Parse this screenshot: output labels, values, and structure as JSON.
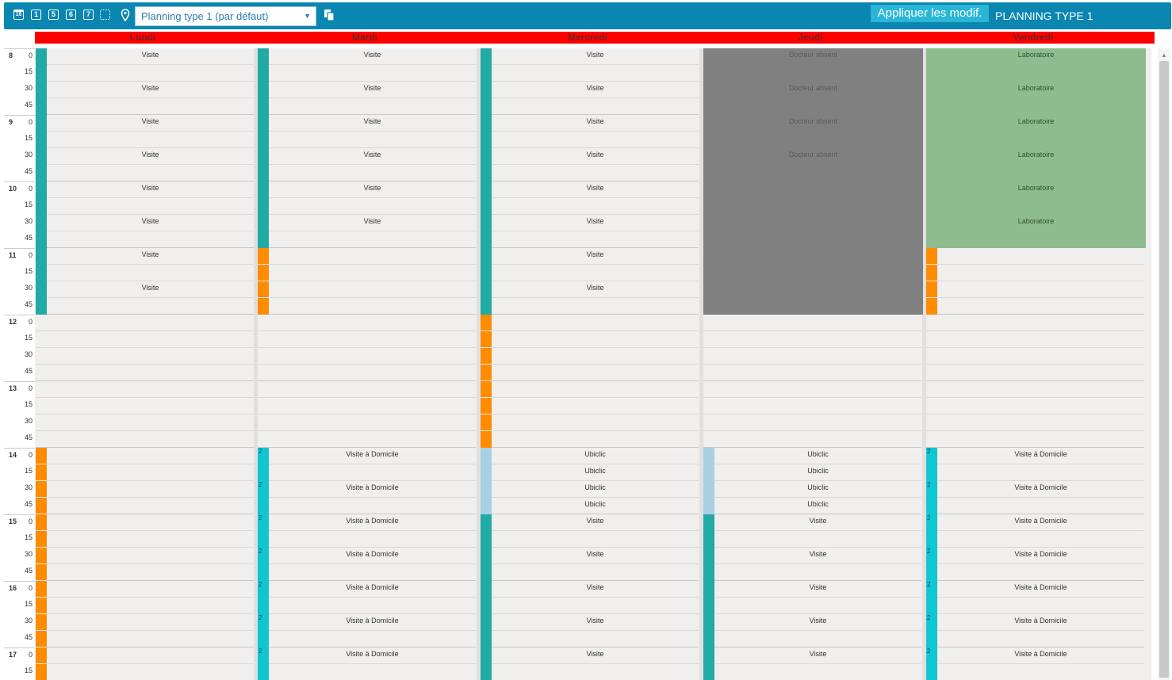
{
  "toolbar": {
    "icons": [
      "calendar-16-icon",
      "day-1-icon",
      "days-5-icon",
      "days-6-icon",
      "days-7-icon",
      "calendar-multi-icon",
      "location-pin-icon",
      "copy-icon"
    ],
    "icon_labels": {
      "cal16": "16",
      "d1": "1",
      "d5": "5",
      "d6": "6",
      "d7": "7"
    },
    "planning_select": {
      "value": "Planning type 1 (par défaut)"
    },
    "apply_label": "Appliquer les modif.",
    "planning_label": "PLANNING TYPE 1",
    "bg_color": "#0a86b0"
  },
  "days": [
    "Lundi",
    "Mardi",
    "Mercredi",
    "Jeudi",
    "Vendredi"
  ],
  "header_color": "#ff0000",
  "time_rows": [
    {
      "hour": "8",
      "min": "0"
    },
    {
      "hour": "",
      "min": "15"
    },
    {
      "hour": "",
      "min": "30"
    },
    {
      "hour": "",
      "min": "45"
    },
    {
      "hour": "9",
      "min": "0"
    },
    {
      "hour": "",
      "min": "15"
    },
    {
      "hour": "",
      "min": "30"
    },
    {
      "hour": "",
      "min": "45"
    },
    {
      "hour": "10",
      "min": "0"
    },
    {
      "hour": "",
      "min": "15"
    },
    {
      "hour": "",
      "min": "30"
    },
    {
      "hour": "",
      "min": "45"
    },
    {
      "hour": "11",
      "min": "0"
    },
    {
      "hour": "",
      "min": "15"
    },
    {
      "hour": "",
      "min": "30"
    },
    {
      "hour": "",
      "min": "45"
    },
    {
      "hour": "12",
      "min": "0"
    },
    {
      "hour": "",
      "min": "15"
    },
    {
      "hour": "",
      "min": "30"
    },
    {
      "hour": "",
      "min": "45"
    },
    {
      "hour": "13",
      "min": "0"
    },
    {
      "hour": "",
      "min": "15"
    },
    {
      "hour": "",
      "min": "30"
    },
    {
      "hour": "",
      "min": "45"
    },
    {
      "hour": "14",
      "min": "0"
    },
    {
      "hour": "",
      "min": "15"
    },
    {
      "hour": "",
      "min": "30"
    },
    {
      "hour": "",
      "min": "45"
    },
    {
      "hour": "15",
      "min": "0"
    },
    {
      "hour": "",
      "min": "15"
    },
    {
      "hour": "",
      "min": "30"
    },
    {
      "hour": "",
      "min": "45"
    },
    {
      "hour": "16",
      "min": "0"
    },
    {
      "hour": "",
      "min": "15"
    },
    {
      "hour": "",
      "min": "30"
    },
    {
      "hour": "",
      "min": "45"
    },
    {
      "hour": "17",
      "min": "0"
    },
    {
      "hour": "",
      "min": "15"
    }
  ],
  "colors": {
    "visite": "#22aaa6",
    "domicile": "#0fc6d1",
    "ubiclic": "#a9cfe3",
    "orange": "#ff8c00",
    "absent": "#808080",
    "lab": "#8fbc8f"
  },
  "schedule": [
    {
      "day": "Lundi",
      "events": [
        {
          "start": "8:00",
          "end": "8:30",
          "type": "visite",
          "label": "Visite"
        },
        {
          "start": "8:30",
          "end": "9:00",
          "type": "visite",
          "label": "Visite"
        },
        {
          "start": "9:00",
          "end": "9:30",
          "type": "visite",
          "label": "Visite"
        },
        {
          "start": "9:30",
          "end": "10:00",
          "type": "visite",
          "label": "Visite"
        },
        {
          "start": "10:00",
          "end": "10:30",
          "type": "visite",
          "label": "Visite"
        },
        {
          "start": "10:30",
          "end": "11:00",
          "type": "visite",
          "label": "Visite"
        },
        {
          "start": "11:00",
          "end": "11:30",
          "type": "visite",
          "label": "Visite"
        },
        {
          "start": "11:30",
          "end": "12:00",
          "type": "visite",
          "label": "Visite"
        },
        {
          "start": "14:00",
          "end": "17:30",
          "type": "orange",
          "label": ""
        }
      ]
    },
    {
      "day": "Mardi",
      "events": [
        {
          "start": "8:00",
          "end": "8:30",
          "type": "visite",
          "label": "Visite"
        },
        {
          "start": "8:30",
          "end": "9:00",
          "type": "visite",
          "label": "Visite"
        },
        {
          "start": "9:00",
          "end": "9:30",
          "type": "visite",
          "label": "Visite"
        },
        {
          "start": "9:30",
          "end": "10:00",
          "type": "visite",
          "label": "Visite"
        },
        {
          "start": "10:00",
          "end": "10:30",
          "type": "visite",
          "label": "Visite"
        },
        {
          "start": "10:30",
          "end": "11:00",
          "type": "visite",
          "label": "Visite"
        },
        {
          "start": "11:00",
          "end": "12:00",
          "type": "orange",
          "label": ""
        },
        {
          "start": "14:00",
          "end": "14:30",
          "type": "domicile",
          "label": "Visite à Domicile",
          "num": "2"
        },
        {
          "start": "14:30",
          "end": "15:00",
          "type": "domicile",
          "label": "Visite à Domicile",
          "num": "2"
        },
        {
          "start": "15:00",
          "end": "15:30",
          "type": "domicile",
          "label": "Visite à Domicile",
          "num": "2"
        },
        {
          "start": "15:30",
          "end": "16:00",
          "type": "domicile",
          "label": "Visite à Domicile",
          "num": "2"
        },
        {
          "start": "16:00",
          "end": "16:30",
          "type": "domicile",
          "label": "Visite à Domicile",
          "num": "2"
        },
        {
          "start": "16:30",
          "end": "17:00",
          "type": "domicile",
          "label": "Visite à Domicile",
          "num": "2"
        },
        {
          "start": "17:00",
          "end": "17:30",
          "type": "domicile",
          "label": "Visite à Domicile",
          "num": "2"
        }
      ]
    },
    {
      "day": "Mercredi",
      "events": [
        {
          "start": "8:00",
          "end": "8:30",
          "type": "visite",
          "label": "Visite"
        },
        {
          "start": "8:30",
          "end": "9:00",
          "type": "visite",
          "label": "Visite"
        },
        {
          "start": "9:00",
          "end": "9:30",
          "type": "visite",
          "label": "Visite"
        },
        {
          "start": "9:30",
          "end": "10:00",
          "type": "visite",
          "label": "Visite"
        },
        {
          "start": "10:00",
          "end": "10:30",
          "type": "visite",
          "label": "Visite"
        },
        {
          "start": "10:30",
          "end": "11:00",
          "type": "visite",
          "label": "Visite"
        },
        {
          "start": "11:00",
          "end": "11:30",
          "type": "visite",
          "label": "Visite"
        },
        {
          "start": "11:30",
          "end": "12:00",
          "type": "visite",
          "label": "Visite"
        },
        {
          "start": "12:00",
          "end": "14:00",
          "type": "orange",
          "label": ""
        },
        {
          "start": "14:00",
          "end": "14:15",
          "type": "ubiclic",
          "label": "Ubiclic"
        },
        {
          "start": "14:15",
          "end": "14:30",
          "type": "ubiclic",
          "label": "Ubiclic"
        },
        {
          "start": "14:30",
          "end": "14:45",
          "type": "ubiclic",
          "label": "Ubiclic"
        },
        {
          "start": "14:45",
          "end": "15:00",
          "type": "ubiclic",
          "label": "Ubiclic"
        },
        {
          "start": "15:00",
          "end": "15:30",
          "type": "visite",
          "label": "Visite"
        },
        {
          "start": "15:30",
          "end": "16:00",
          "type": "visite",
          "label": "Visite"
        },
        {
          "start": "16:00",
          "end": "16:30",
          "type": "visite",
          "label": "Visite"
        },
        {
          "start": "16:30",
          "end": "17:00",
          "type": "visite",
          "label": "Visite"
        },
        {
          "start": "17:00",
          "end": "17:30",
          "type": "visite",
          "label": "Visite"
        }
      ]
    },
    {
      "day": "Jeudi",
      "events": [
        {
          "start": "8:00",
          "end": "12:00",
          "type": "absent",
          "label": "Docteur absent",
          "sublabels": [
            "Docteur absent",
            "Docteur absent",
            "Docteur absent",
            "Docteur absent"
          ]
        },
        {
          "start": "14:00",
          "end": "14:15",
          "type": "ubiclic",
          "label": "Ubiclic"
        },
        {
          "start": "14:15",
          "end": "14:30",
          "type": "ubiclic",
          "label": "Ubiclic"
        },
        {
          "start": "14:30",
          "end": "14:45",
          "type": "ubiclic",
          "label": "Ubiclic"
        },
        {
          "start": "14:45",
          "end": "15:00",
          "type": "ubiclic",
          "label": "Ubiclic"
        },
        {
          "start": "15:00",
          "end": "15:30",
          "type": "visite",
          "label": "Visite"
        },
        {
          "start": "15:30",
          "end": "16:00",
          "type": "visite",
          "label": "Visite"
        },
        {
          "start": "16:00",
          "end": "16:30",
          "type": "visite",
          "label": "Visite"
        },
        {
          "start": "16:30",
          "end": "17:00",
          "type": "visite",
          "label": "Visite"
        },
        {
          "start": "17:00",
          "end": "17:30",
          "type": "visite",
          "label": "Visite"
        }
      ]
    },
    {
      "day": "Vendredi",
      "events": [
        {
          "start": "8:00",
          "end": "11:00",
          "type": "lab",
          "label": "Laboratoire",
          "sublabels": [
            "Laboratoire",
            "Laboratoire",
            "Laboratoire",
            "Laboratoire",
            "Laboratoire",
            "Laboratoire"
          ]
        },
        {
          "start": "11:00",
          "end": "12:00",
          "type": "orange",
          "label": ""
        },
        {
          "start": "14:00",
          "end": "14:30",
          "type": "domicile",
          "label": "Visite à Domicile",
          "num": "2"
        },
        {
          "start": "14:30",
          "end": "15:00",
          "type": "domicile",
          "label": "Visite à Domicile",
          "num": "2"
        },
        {
          "start": "15:00",
          "end": "15:30",
          "type": "domicile",
          "label": "Visite à Domicile",
          "num": "2"
        },
        {
          "start": "15:30",
          "end": "16:00",
          "type": "domicile",
          "label": "Visite à Domicile",
          "num": "2"
        },
        {
          "start": "16:00",
          "end": "16:30",
          "type": "domicile",
          "label": "Visite à Domicile",
          "num": "2"
        },
        {
          "start": "16:30",
          "end": "17:00",
          "type": "domicile",
          "label": "Visite à Domicile",
          "num": "2"
        },
        {
          "start": "17:00",
          "end": "17:30",
          "type": "domicile",
          "label": "Visite à Domicile",
          "num": "2"
        }
      ]
    }
  ]
}
